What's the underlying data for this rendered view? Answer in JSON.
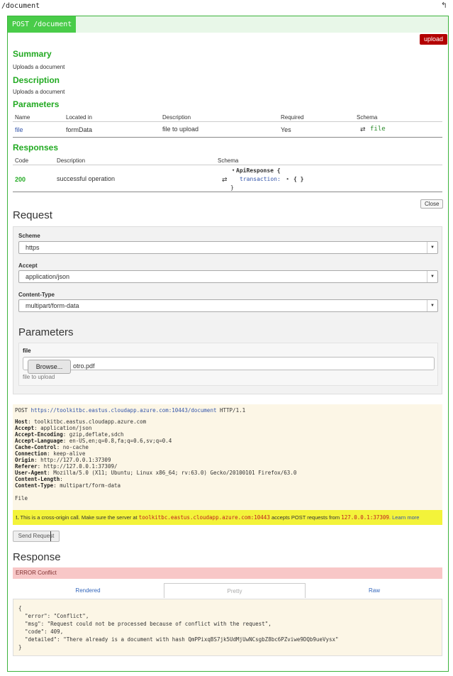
{
  "topbar": {
    "path": "/document",
    "back_icon": "back-arrow-icon"
  },
  "operation": {
    "verb_path": "POST /document",
    "tag": "upload",
    "summary_title": "Summary",
    "summary": "Uploads a document",
    "description_title": "Description",
    "description": "Uploads a document",
    "parameters_title": "Parameters",
    "param_headers": [
      "Name",
      "Located in",
      "Description",
      "Required",
      "Schema"
    ],
    "params": [
      {
        "name": "file",
        "located_in": "formData",
        "description": "file to upload",
        "required": "Yes",
        "schema": "file"
      }
    ],
    "responses_title": "Responses",
    "resp_headers": [
      "Code",
      "Description",
      "Schema"
    ],
    "responses": [
      {
        "code": "200",
        "description": "successful operation",
        "schema_line1": "ApiResponse {",
        "schema_line2": "transaction:",
        "schema_line2b": "{ }",
        "schema_line3": "}"
      }
    ],
    "close_label": "Close"
  },
  "request": {
    "title": "Request",
    "scheme_label": "Scheme",
    "scheme_value": "https",
    "accept_label": "Accept",
    "accept_value": "application/json",
    "content_type_label": "Content-Type",
    "content_type_value": "multipart/form-data",
    "params_title": "Parameters",
    "file_label": "file",
    "browse_label": "Browse...",
    "file_name": "otro.pdf",
    "file_hint": "file to upload"
  },
  "http": {
    "method": "POST",
    "url": "https://toolkitbc.eastus.cloudapp.azure.com:10443/document",
    "version": "HTTP/1.1",
    "headers": [
      {
        "k": "Host",
        "v": "toolkitbc.eastus.cloudapp.azure.com"
      },
      {
        "k": "Accept",
        "v": "application/json"
      },
      {
        "k": "Accept-Encoding",
        "v": "gzip,deflate,sdch"
      },
      {
        "k": "Accept-Language",
        "v": "en-US,en;q=0.8,fa;q=0.6,sv;q=0.4"
      },
      {
        "k": "Cache-Control",
        "v": "no-cache"
      },
      {
        "k": "Connection",
        "v": "keep-alive"
      },
      {
        "k": "Origin",
        "v": "http://127.0.0.1:37309"
      },
      {
        "k": "Referer",
        "v": "http://127.0.0.1:37309/"
      },
      {
        "k": "User-Agent",
        "v": "Mozilla/5.0 (X11; Ubuntu; Linux x86_64; rv:63.0) Gecko/20100101 Firefox/63.0"
      },
      {
        "k": "Content-Length",
        "v": ""
      },
      {
        "k": "Content-Type",
        "v": "multipart/form-data"
      }
    ],
    "body": "File"
  },
  "warning": {
    "prefix": "!.",
    "text1": "This is a cross-origin call. Make sure the server at",
    "server": "toolkitbc.eastus.cloudapp.azure.com:10443",
    "text2": "accepts POST requests from",
    "origin": "127.0.0.1:37309",
    "learn_more": "Learn more"
  },
  "send_label": "Send Request",
  "response": {
    "title": "Response",
    "status": "ERROR Conflict",
    "tabs": [
      "Rendered",
      "Pretty",
      "Raw"
    ],
    "body_lines": [
      "{",
      "  \"error\": \"Conflict\",",
      "  \"msg\": \"Request could not be processed because of conflict with the request\",",
      "  \"code\": 409,",
      "  \"detailed\": \"There already is a document with hash QmPPixqBS7jk5UdMjUwNCsgbZ8bc6PZviwe9DQb9ueVysx\"",
      "}"
    ]
  },
  "colors": {
    "accent_green": "#49cc49",
    "tag_red": "#b30000",
    "warning_yellow": "#f3f33a",
    "error_pink": "#f8c7c7"
  }
}
